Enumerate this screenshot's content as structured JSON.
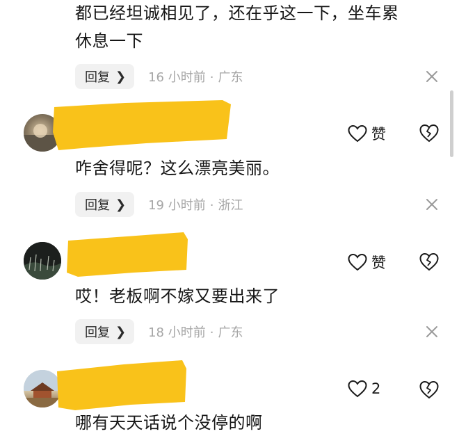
{
  "comments": [
    {
      "text_lines": [
        "都已经坦诚相见了，还在乎这一下，坐车累",
        "休息一下"
      ],
      "reply_label": "回复",
      "time": "16 小时前",
      "location": "广东"
    },
    {
      "like_label": "赞",
      "text": "咋舍得呢？这么漂亮美丽。",
      "reply_label": "回复",
      "time": "19 小时前",
      "location": "浙江"
    },
    {
      "like_label": "赞",
      "text": "哎！老板啊不嫁又要出来了",
      "reply_label": "回复",
      "time": "18 小时前",
      "location": "广东"
    },
    {
      "like_label": "2",
      "text": "哪有天天话说个没停的啊"
    }
  ],
  "colors": {
    "redaction": "#f9c21a",
    "meta": "#a6a6a6",
    "reply_bg": "#f1f1f1"
  },
  "icons": {
    "like": "heart-outline-icon",
    "dislike": "broken-heart-icon",
    "close": "close-icon",
    "chevron": "chevron-right-icon"
  }
}
